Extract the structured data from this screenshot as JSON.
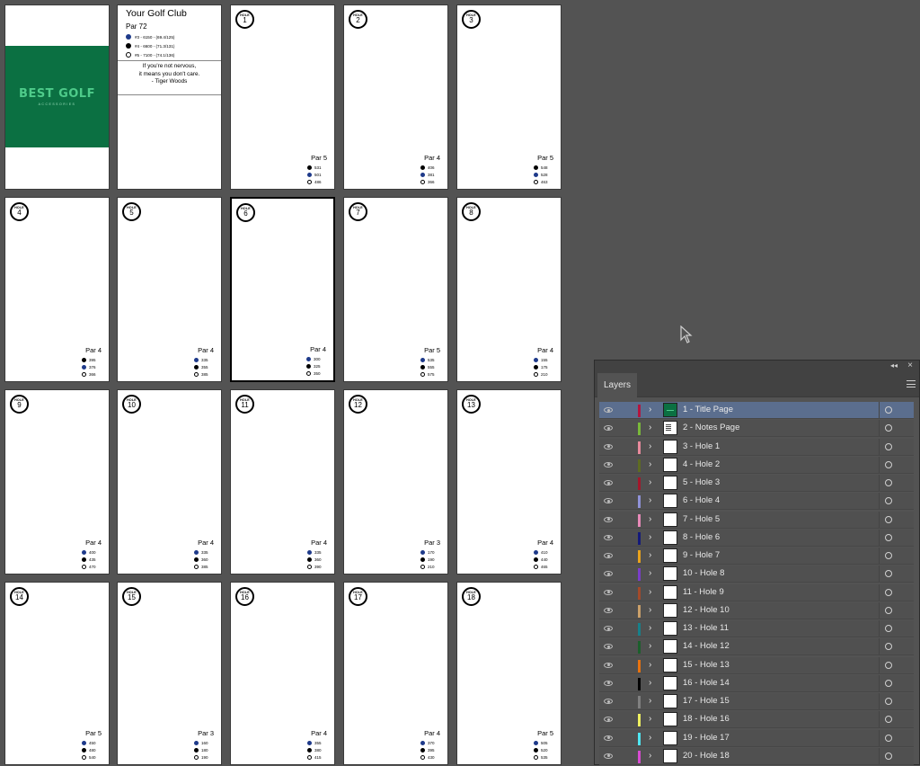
{
  "title_page": {
    "logo_text": "BEST GOLF",
    "logo_sub": "ACCESSORIES",
    "brand_color": "#0b7042"
  },
  "notes_page": {
    "club_name": "Your Golf Club",
    "par_total": "Par 72",
    "tees": [
      {
        "color": "blue",
        "text": "#3 - 6150 - (69.4/125)"
      },
      {
        "color": "black",
        "text": "#4 - 6600 - (71.3/131)"
      },
      {
        "color": "white",
        "text": "#5 - 7100 - (74.1/136)"
      }
    ],
    "quote_lines": [
      "If you're not nervous,",
      "it means you don't care.",
      "- Tiger Woods"
    ]
  },
  "hole_word": "HOLE",
  "holes": [
    {
      "num": "1",
      "par": "Par 5",
      "yds": [
        "531",
        "501",
        "486"
      ],
      "tees": [
        "black",
        "blue",
        "white"
      ]
    },
    {
      "num": "2",
      "par": "Par 4",
      "yds": [
        "406",
        "381",
        "366"
      ],
      "tees": [
        "black",
        "blue",
        "white"
      ]
    },
    {
      "num": "3",
      "par": "Par 5",
      "yds": [
        "548",
        "528",
        "463"
      ],
      "tees": [
        "black",
        "blue",
        "white"
      ]
    },
    {
      "num": "4",
      "par": "Par 4",
      "yds": [
        "395",
        "376",
        "366"
      ],
      "tees": [
        "black",
        "blue",
        "white"
      ]
    },
    {
      "num": "5",
      "par": "Par 4",
      "yds": [
        "335",
        "355",
        "385"
      ],
      "tees": [
        "blue",
        "black",
        "white"
      ]
    },
    {
      "num": "6",
      "par": "Par 4",
      "yds": [
        "300",
        "325",
        "350"
      ],
      "tees": [
        "blue",
        "black",
        "white"
      ]
    },
    {
      "num": "7",
      "par": "Par 5",
      "yds": [
        "535",
        "555",
        "575"
      ],
      "tees": [
        "blue",
        "black",
        "white"
      ]
    },
    {
      "num": "8",
      "par": "Par 4",
      "yds": [
        "155",
        "175",
        "210"
      ],
      "tees": [
        "blue",
        "black",
        "white"
      ]
    },
    {
      "num": "9",
      "par": "Par 4",
      "yds": [
        "400",
        "435",
        "470"
      ],
      "tees": [
        "blue",
        "black",
        "white"
      ]
    },
    {
      "num": "10",
      "par": "Par 4",
      "yds": [
        "335",
        "360",
        "385"
      ],
      "tees": [
        "blue",
        "black",
        "white"
      ]
    },
    {
      "num": "11",
      "par": "Par 4",
      "yds": [
        "335",
        "360",
        "390"
      ],
      "tees": [
        "blue",
        "black",
        "white"
      ]
    },
    {
      "num": "12",
      "par": "Par 3",
      "yds": [
        "170",
        "190",
        "210"
      ],
      "tees": [
        "blue",
        "black",
        "white"
      ]
    },
    {
      "num": "13",
      "par": "Par 4",
      "yds": [
        "410",
        "440",
        "465"
      ],
      "tees": [
        "blue",
        "black",
        "white"
      ]
    },
    {
      "num": "14",
      "par": "Par 5",
      "yds": [
        "450",
        "480",
        "540"
      ],
      "tees": [
        "blue",
        "black",
        "white"
      ]
    },
    {
      "num": "15",
      "par": "Par 3",
      "yds": [
        "160",
        "180",
        "190"
      ],
      "tees": [
        "blue",
        "black",
        "white"
      ]
    },
    {
      "num": "16",
      "par": "Par 4",
      "yds": [
        "355",
        "380",
        "415"
      ],
      "tees": [
        "blue",
        "black",
        "white"
      ]
    },
    {
      "num": "17",
      "par": "Par 4",
      "yds": [
        "370",
        "395",
        "430"
      ],
      "tees": [
        "blue",
        "black",
        "white"
      ]
    },
    {
      "num": "18",
      "par": "Par 5",
      "yds": [
        "505",
        "520",
        "535"
      ],
      "tees": [
        "blue",
        "black",
        "white"
      ]
    }
  ],
  "layers_panel": {
    "tab_label": "Layers",
    "collapse_glyph": "◂◂",
    "close_glyph": "×",
    "chevron_glyph": "›",
    "layers": [
      {
        "name": "1 - Title Page",
        "color": "#b3163f",
        "thumb": "green",
        "selected": true
      },
      {
        "name": "2 - Notes Page",
        "color": "#79b83a",
        "thumb": "notes"
      },
      {
        "name": "3 - Hole 1",
        "color": "#e88a9c",
        "thumb": "white"
      },
      {
        "name": "4 - Hole 2",
        "color": "#5e6b22",
        "thumb": "white"
      },
      {
        "name": "5 - Hole 3",
        "color": "#a3172b",
        "thumb": "white"
      },
      {
        "name": "6 - Hole 4",
        "color": "#8f92d8",
        "thumb": "white"
      },
      {
        "name": "7 - Hole 5",
        "color": "#e78ab8",
        "thumb": "white"
      },
      {
        "name": "8 - Hole 6",
        "color": "#141a7a",
        "thumb": "white"
      },
      {
        "name": "9 - Hole 7",
        "color": "#e8a21c",
        "thumb": "white"
      },
      {
        "name": "10 - Hole 8",
        "color": "#7a3dc9",
        "thumb": "white"
      },
      {
        "name": "11 - Hole 9",
        "color": "#a34a2a",
        "thumb": "white"
      },
      {
        "name": "12 - Hole 10",
        "color": "#caa06a",
        "thumb": "white"
      },
      {
        "name": "13 - Hole 11",
        "color": "#17808a",
        "thumb": "white"
      },
      {
        "name": "14 - Hole 12",
        "color": "#1c5f2c",
        "thumb": "white"
      },
      {
        "name": "15 - Hole 13",
        "color": "#e8720f",
        "thumb": "white"
      },
      {
        "name": "16 - Hole 14",
        "color": "#000000",
        "thumb": "white"
      },
      {
        "name": "17 - Hole 15",
        "color": "#808080",
        "thumb": "white"
      },
      {
        "name": "18 - Hole 16",
        "color": "#eef060",
        "thumb": "white"
      },
      {
        "name": "19 - Hole 17",
        "color": "#4fe6f2",
        "thumb": "white"
      },
      {
        "name": "20 - Hole 18",
        "color": "#d84bd2",
        "thumb": "white"
      }
    ]
  }
}
